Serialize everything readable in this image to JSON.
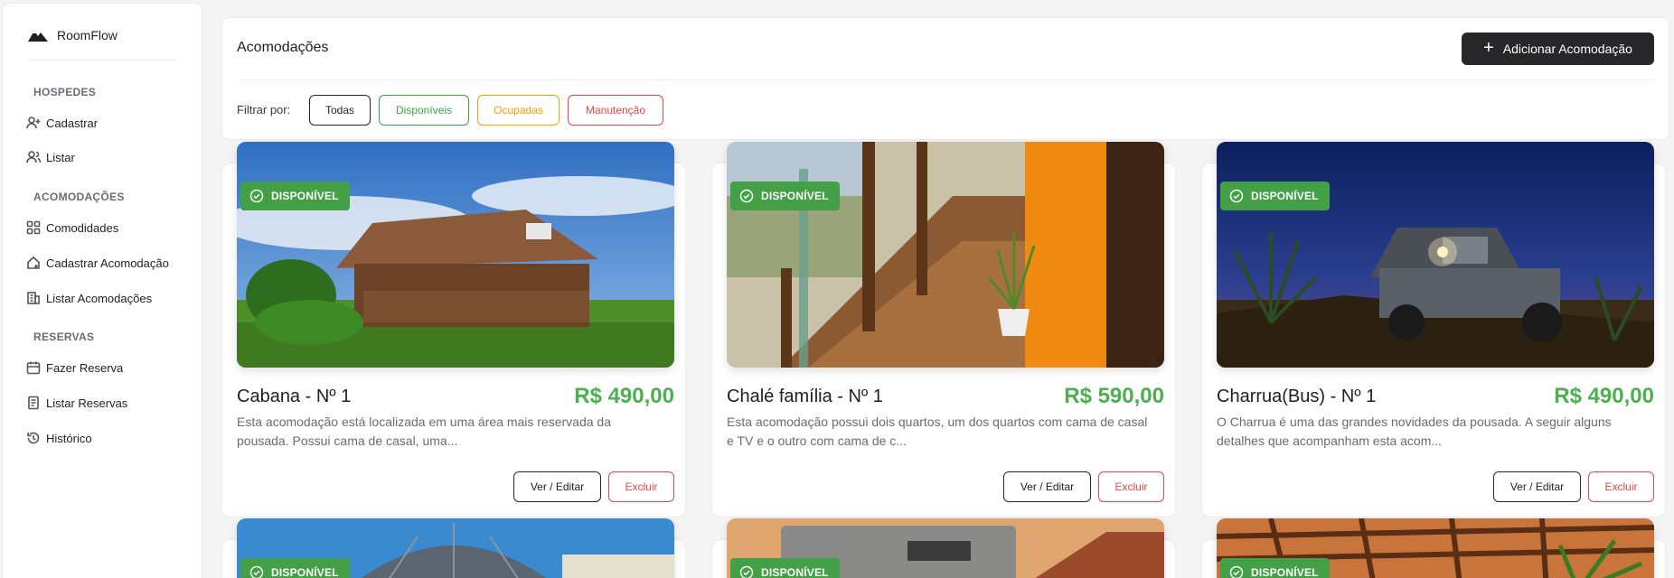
{
  "app": {
    "name": "RoomFlow"
  },
  "sidebar": {
    "sections": [
      {
        "title": "HOSPEDES",
        "items": [
          {
            "label": "Cadastrar",
            "icon": "user-plus-icon"
          },
          {
            "label": "Listar",
            "icon": "users-icon"
          }
        ]
      },
      {
        "title": "ACOMODAÇÕES",
        "items": [
          {
            "label": "Comodidades",
            "icon": "grid-icon"
          },
          {
            "label": "Cadastrar Acomodação",
            "icon": "house-plus-icon"
          },
          {
            "label": "Listar Acomodações",
            "icon": "building-icon"
          }
        ]
      },
      {
        "title": "RESERVAS",
        "items": [
          {
            "label": "Fazer Reserva",
            "icon": "calendar-icon"
          },
          {
            "label": "Listar Reservas",
            "icon": "document-icon"
          },
          {
            "label": "Histórico",
            "icon": "history-icon"
          }
        ]
      }
    ]
  },
  "header": {
    "title": "Acomodações",
    "add_button": "Adicionar Acomodação",
    "filter_label": "Filtrar por:",
    "filters": [
      "Todas",
      "Disponíveis",
      "Ocupadas",
      "Manutenção"
    ],
    "colors": {
      "available": "#37a746",
      "occupied": "#f59e0b",
      "maintenance": "#ef4444",
      "dark": "#27272a"
    }
  },
  "cards": [
    {
      "status": "DISPONÍVEL",
      "title": "Cabana - Nº 1",
      "price": "R$ 490,00",
      "description": "Esta acomodação está localizada em uma área mais reservada da pousada. Possui cama de casal, uma...",
      "edit": "Ver / Editar",
      "delete": "Excluir"
    },
    {
      "status": "DISPONÍVEL",
      "title": "Chalé família - Nº 1",
      "price": "R$ 590,00",
      "description": "Esta acomodação possui dois quartos, um dos quartos com cama de casal e TV e o outro com cama de c...",
      "edit": "Ver / Editar",
      "delete": "Excluir"
    },
    {
      "status": "DISPONÍVEL",
      "title": "Charrua(Bus) - Nº 1",
      "price": "R$ 490,00",
      "description": "O Charrua é uma das grandes novidades da pousada. A seguir alguns detalhes que acompanham esta acom...",
      "edit": "Ver / Editar",
      "delete": "Excluir"
    },
    {
      "status": "DISPONÍVEL"
    },
    {
      "status": "DISPONÍVEL"
    },
    {
      "status": "DISPONÍVEL"
    }
  ]
}
